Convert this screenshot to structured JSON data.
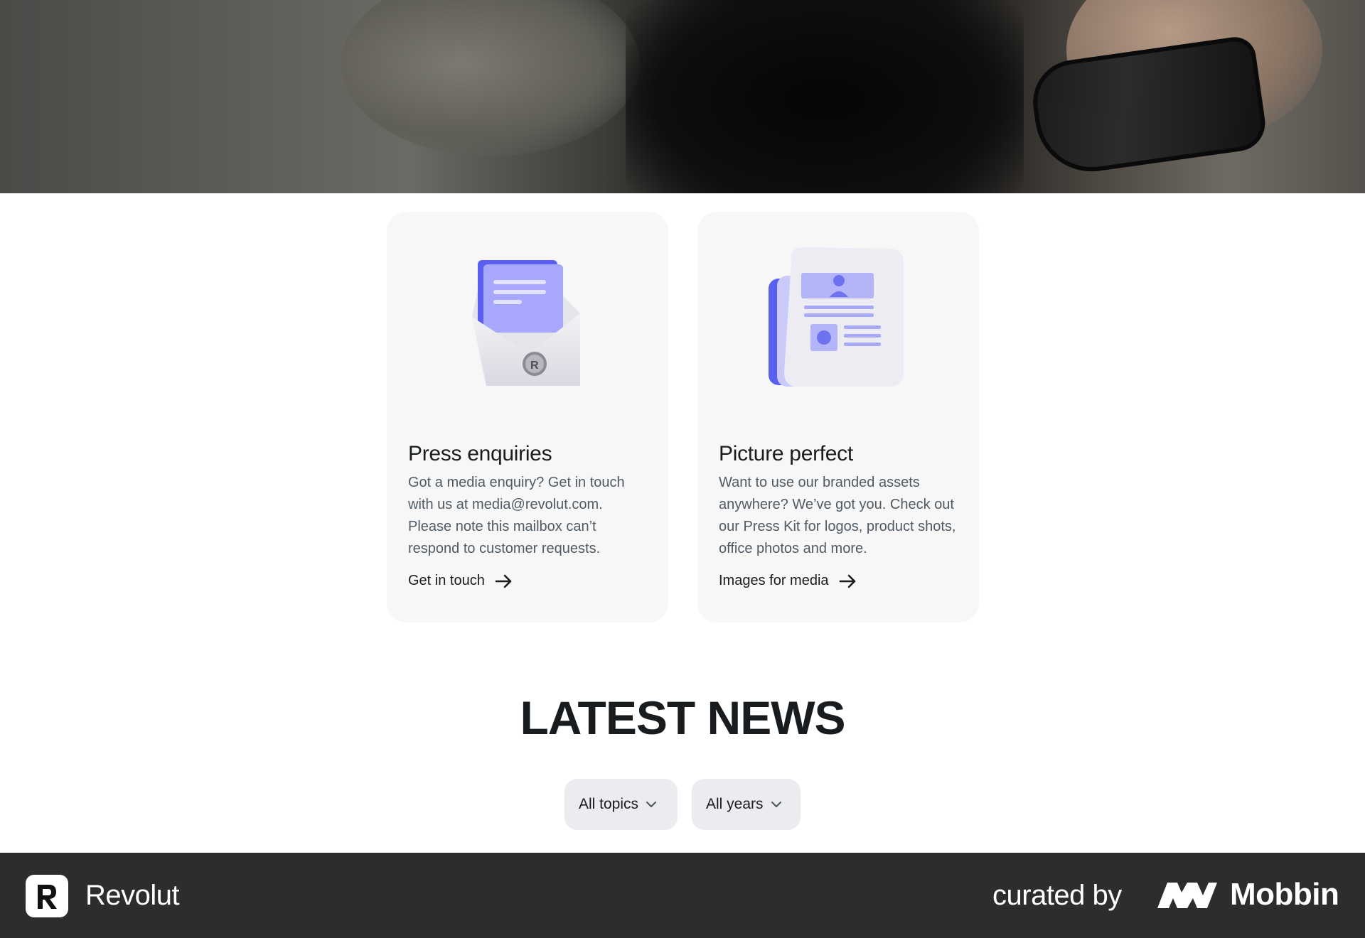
{
  "hero": {
    "image_alt": "Close-up of a person wearing a black wristwatch"
  },
  "cards": [
    {
      "title": "Press enquiries",
      "description": "Got a media enquiry? Get in touch with us at media@revolut.com. Please note this mailbox can’t respond to customer requests.",
      "link_label": "Get in touch",
      "illustration": "envelope-icon"
    },
    {
      "title": "Picture perfect",
      "description": "Want to use our branded assets anywhere? We’ve got you. Check out our Press Kit for logos, product shots, office photos and more.",
      "link_label": "Images for media",
      "illustration": "newspaper-icon"
    }
  ],
  "news": {
    "title": "LATEST NEWS",
    "filters": [
      {
        "label": "All topics"
      },
      {
        "label": "All years"
      }
    ]
  },
  "footer": {
    "brand_name": "Revolut",
    "curated_label": "curated by",
    "curator_name": "Mobbin"
  },
  "colors": {
    "accent": "#7b7ff5",
    "card_bg": "#f7f7f7",
    "filter_bg": "#ebebf0",
    "footer_bg": "#2d2d2d"
  }
}
